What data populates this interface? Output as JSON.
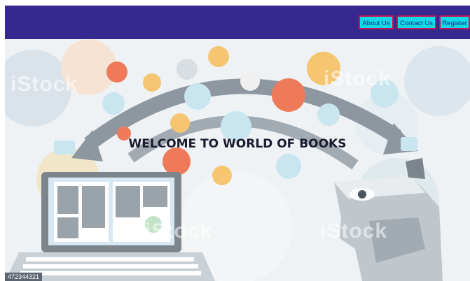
{
  "nav": {
    "about_label": "About Us",
    "contact_label": "Contact Us",
    "register_label": "Register"
  },
  "hero": {
    "title": "WELCOME TO WORLD OF BOOKS",
    "image_id": "472344321",
    "watermark": "iStock"
  },
  "colors": {
    "navbar": "#35288f",
    "button_bg": "#14d8e6",
    "button_border": "#c2185b"
  }
}
